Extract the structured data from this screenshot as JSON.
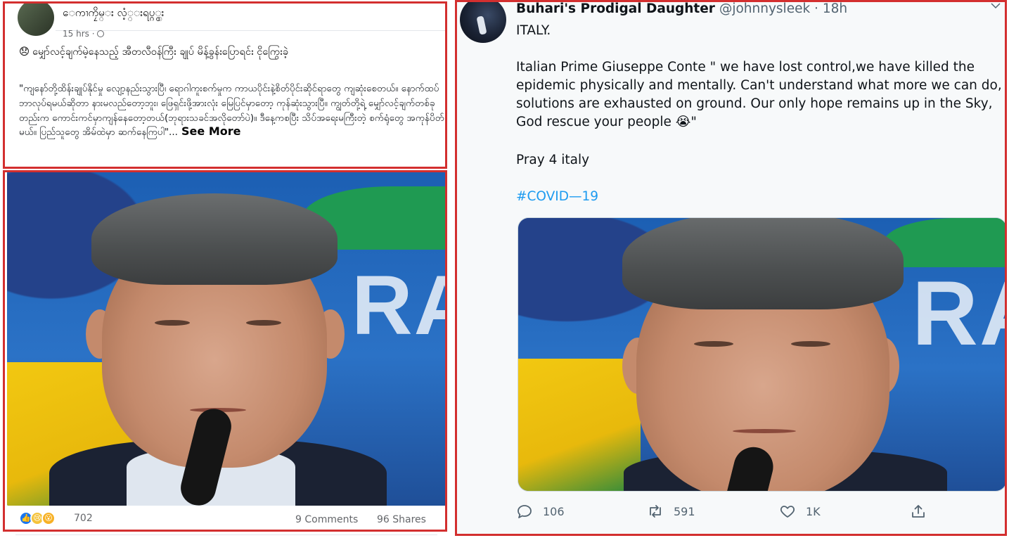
{
  "facebook": {
    "page_name": "ေကၢကၠိမ္း လံ့္းရပ္ဂ္ွး",
    "meta": "15 hrs · ",
    "headline_emoji": "😞",
    "headline": "မျှော်လင့်ချက်မဲ့နေသည့် အီတလီဝန်ကြီး ချုပ် မိန့်ခွန်းပြောရင်း ငိုကြွေးခဲ့",
    "body": "\"ကျနော်တို့ထိန်းချုပ်နိုင်မှု လျော့နည်းသွားပြီ၊ ရောဂါကူးစက်မှုက ကာယပိုင်းနဲ့စိတ်ပိုင်းဆိုင်ရာတွေ ကျဆုံးစေတယ်။ နောက်ထပ်ဘာလုပ်ရမယ်ဆိုတာ နားမလည်တော့ဘူး၊ ဖြေရှင်းဖို့အားလုံး မြေပြင်မှာတော့ ကုန်ဆုံးသွားပြီ။ ကျွတ်တို့ရဲ့ မျှော်လင့်ချက်တစ်ခုတည်းက ကောင်းကင်မှာကျန်နေတော့တယ်(ဘုရားသခင်အလိုတော်ပဲ)။ ဒီနေ့ကစပြီး သိပ်အရေးမကြီးတဲ့ စက်ရုံတွေ အကုန်ပိတ်မယ်။ ပြည်သူတွေ အိမ်ထဲမှာ ဆက်နေကြပါ\"...",
    "see_more": "See More",
    "reaction_count": "702",
    "comments": "9 Comments",
    "shares": "96 Shares"
  },
  "twitter": {
    "name": "Buhari's Prodigal Daughter",
    "handle": "@johnnysleek",
    "time": " · 18h",
    "line1": "ITALY.",
    "quote_l1": "Italian Prime Giuseppe Conte \" we have lost control,we have killed the",
    "quote_l2": "epidemic physically and mentally. Can't understand what more we can do, al",
    "quote_l3": "solutions are exhausted on ground. Our only hope remains up in the Sky,",
    "quote_l4": "God rescue your people ",
    "quote_emoji": "😭",
    "quote_end": "\"",
    "pray": "Pray 4 italy",
    "hashtag": "#COVID—19",
    "replies": "106",
    "retweets": "591",
    "likes": "1K",
    "photo_letters": "RA"
  },
  "colors": {
    "frame_red": "#d32f2f",
    "twitter_link": "#1d9bf0",
    "facebook_like": "#1877f2"
  }
}
